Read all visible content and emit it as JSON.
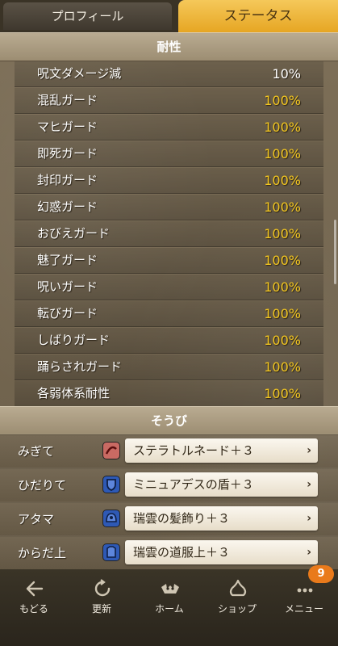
{
  "tabs": {
    "profile": "プロフィール",
    "status": "ステータス"
  },
  "resist": {
    "title": "耐性",
    "rows": [
      {
        "label": "呪文ダメージ減",
        "value": "10%"
      },
      {
        "label": "混乱ガード",
        "value": "100%"
      },
      {
        "label": "マヒガード",
        "value": "100%"
      },
      {
        "label": "即死ガード",
        "value": "100%"
      },
      {
        "label": "封印ガード",
        "value": "100%"
      },
      {
        "label": "幻惑ガード",
        "value": "100%"
      },
      {
        "label": "おびえガード",
        "value": "100%"
      },
      {
        "label": "魅了ガード",
        "value": "100%"
      },
      {
        "label": "呪いガード",
        "value": "100%"
      },
      {
        "label": "転びガード",
        "value": "100%"
      },
      {
        "label": "しばりガード",
        "value": "100%"
      },
      {
        "label": "踊らされガード",
        "value": "100%"
      },
      {
        "label": "各弱体系耐性",
        "value": "100%"
      }
    ]
  },
  "equipment": {
    "title": "そうび",
    "items": [
      {
        "slot": "みぎて",
        "name": "ステラトルネード＋３",
        "icon": "whip-icon"
      },
      {
        "slot": "ひだりて",
        "name": "ミニュアデスの盾＋３",
        "icon": "shield-icon"
      },
      {
        "slot": "アタマ",
        "name": "瑞雲の髪飾り＋３",
        "icon": "helmet-icon"
      },
      {
        "slot": "からだ上",
        "name": "瑞雲の道服上＋３",
        "icon": "armor-icon"
      }
    ]
  },
  "nav": {
    "back": "もどる",
    "refresh": "更新",
    "home": "ホーム",
    "shop": "ショップ",
    "menu": "メニュー",
    "menu_badge": "9"
  },
  "colors": {
    "accent": "#f1c520",
    "tab_active": "#f5c85a",
    "badge": "#e97a1b"
  }
}
